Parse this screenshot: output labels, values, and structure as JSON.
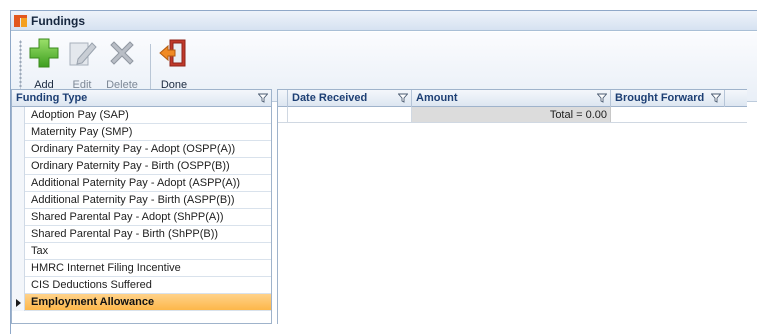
{
  "window": {
    "title": "Fundings"
  },
  "toolbar": {
    "add_label": "Add",
    "edit_label": "Edit",
    "delete_label": "Delete",
    "done_label": "Done"
  },
  "funding_grid": {
    "column_header": "Funding Type",
    "rows": [
      "Adoption Pay (SAP)",
      "Maternity Pay (SMP)",
      "Ordinary Paternity Pay - Adopt (OSPP(A))",
      "Ordinary Paternity Pay - Birth (OSPP(B))",
      "Additional Paternity Pay - Adopt (ASPP(A))",
      "Additional Paternity Pay - Birth (ASPP(B))",
      "Shared Parental Pay - Adopt (ShPP(A))",
      "Shared Parental Pay - Birth (ShPP(B))",
      "Tax",
      "HMRC Internet Filing Incentive",
      "CIS Deductions Suffered",
      "Employment Allowance"
    ],
    "selected_row": "Employment Allowance"
  },
  "detail_grid": {
    "columns": [
      "Date Received",
      "Amount",
      "Brought Forward"
    ],
    "total_text": "Total = 0.00"
  },
  "colors": {
    "header_text": "#1d3f74",
    "selected_row": "#fdb74a",
    "border": "#9fb3cb"
  },
  "icons": [
    "app-logo-icon",
    "add-plus-icon",
    "edit-pencil-icon",
    "delete-x-icon",
    "done-exit-door-icon",
    "filter-funnel-icon",
    "row-pointer-icon"
  ]
}
